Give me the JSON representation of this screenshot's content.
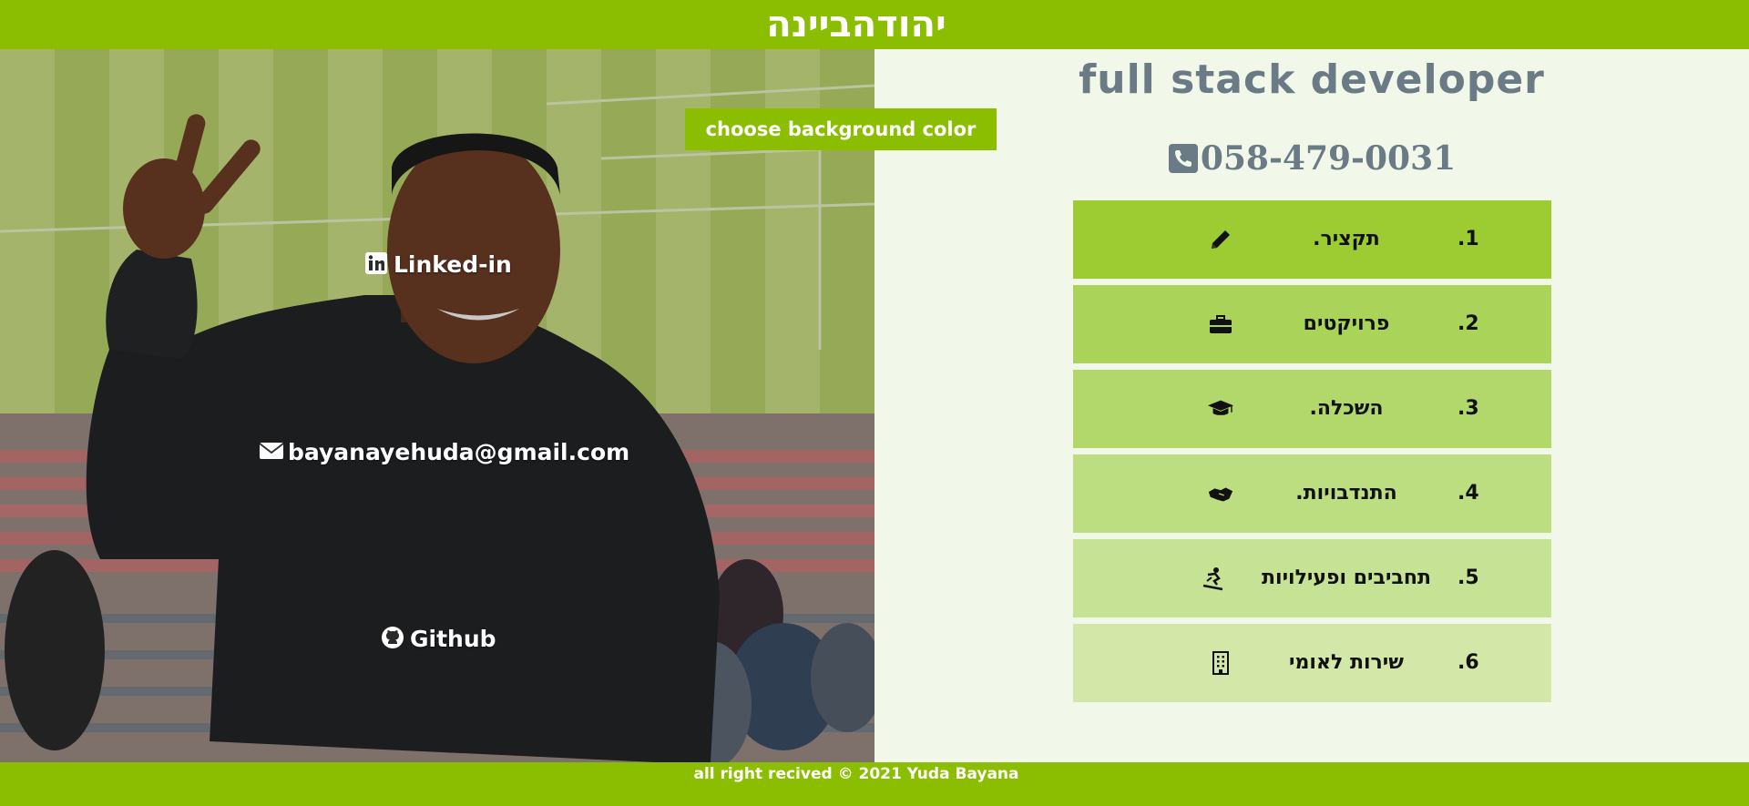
{
  "header": {
    "title": "יהודהביינה"
  },
  "controls": {
    "bg_color_button": "choose background color"
  },
  "contacts": {
    "linkedin": {
      "label": "Linked-in",
      "icon": "linkedin-icon"
    },
    "email": {
      "label": "bayanayehuda@gmail.com",
      "icon": "envelope-icon"
    },
    "github": {
      "label": "Github",
      "icon": "github-icon"
    }
  },
  "profile": {
    "role": "full stack developer",
    "phone": "058-479-0031",
    "phone_icon": "phone-icon"
  },
  "menu": [
    {
      "num": ".1",
      "label": "תקציר.",
      "icon": "pencil-icon",
      "color": "#9ccc32"
    },
    {
      "num": ".2",
      "label": "פרויקטים",
      "icon": "briefcase-icon",
      "color": "#aad35a"
    },
    {
      "num": ".3",
      "label": "השכלה.",
      "icon": "graduation-cap-icon",
      "color": "#b2d86b"
    },
    {
      "num": ".4",
      "label": "התנדבויות.",
      "icon": "handshake-icon",
      "color": "#bcdd80"
    },
    {
      "num": ".5",
      "label": "תחביבים ופעילויות",
      "icon": "snowboarding-icon",
      "color": "#c6e294"
    },
    {
      "num": ".6",
      "label": "שירות לאומי",
      "icon": "building-icon",
      "color": "#d2e7a8"
    }
  ],
  "footer": {
    "text": "all right recived © 2021 Yuda Bayana"
  },
  "colors": {
    "accent": "#8bbe00",
    "page_bg": "#f1f8e9",
    "title_gray": "#6b7b86"
  }
}
